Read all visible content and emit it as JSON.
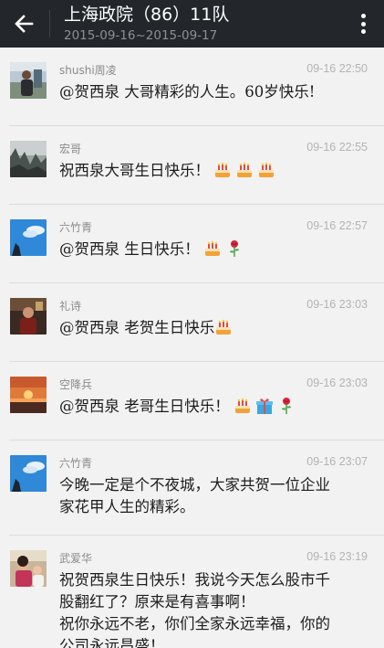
{
  "header": {
    "back_icon": "back-arrow-icon",
    "title": "上海政院（86）11队",
    "subtitle": "2015-09-16~2015-09-17",
    "menu_icon": "more-vertical-icon"
  },
  "messages": [
    {
      "sender": "shushi周凌",
      "time": "09-16 22:50",
      "text": "@贺西泉 大哥精彩的人生。60岁快乐!",
      "lines": [],
      "emojis": []
    },
    {
      "sender": "宏哥",
      "time": "09-16 22:55",
      "text": "祝西泉大哥生日快乐！",
      "lines": [],
      "emojis": [
        "birthday-cake-icon",
        "birthday-cake-icon",
        "birthday-cake-icon"
      ]
    },
    {
      "sender": "六竹青",
      "time": "09-16 22:57",
      "text": "@贺西泉 生日快乐！",
      "lines": [],
      "emojis": [
        "birthday-cake-icon",
        "rose-icon"
      ]
    },
    {
      "sender": "礼诗",
      "time": "09-16 23:03",
      "text": "@贺西泉 老贺生日快乐",
      "lines": [],
      "emojis": [
        "birthday-cake-icon"
      ]
    },
    {
      "sender": "空降兵",
      "time": "09-16 23:03",
      "text": "@贺西泉 老哥生日快乐！",
      "lines": [],
      "emojis": [
        "birthday-cake-icon",
        "gift-icon",
        "rose-icon"
      ]
    },
    {
      "sender": "六竹青",
      "time": "09-16 23:07",
      "text": "",
      "lines": [
        "今晚一定是个不夜城，大家共贺一位企业",
        "家花甲人生的精彩。"
      ],
      "emojis": []
    },
    {
      "sender": "武爱华",
      "time": "09-16 23:19",
      "text": "",
      "lines": [
        "祝贺西泉生日快乐！我说今天怎么股市千",
        "股翻红了？原来是有喜事啊！",
        "祝你永远不老，你们全家永远幸福，你的",
        "公司永远昌盛！"
      ],
      "emojis": []
    }
  ]
}
